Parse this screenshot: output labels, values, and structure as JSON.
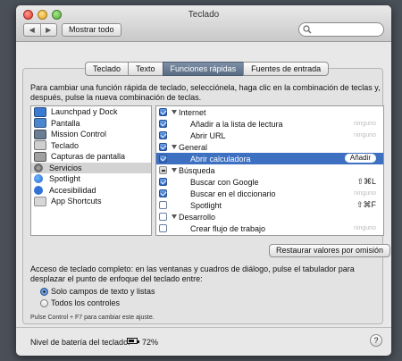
{
  "window": {
    "title": "Teclado"
  },
  "toolbar": {
    "back": "◀",
    "forward": "▶",
    "show_all": "Mostrar todo"
  },
  "tabs": [
    {
      "label": "Teclado",
      "active": false
    },
    {
      "label": "Texto",
      "active": false
    },
    {
      "label": "Funciones rápidas",
      "active": true
    },
    {
      "label": "Fuentes de entrada",
      "active": false
    }
  ],
  "intro": "Para cambiar una función rápida de teclado, selecciónela, haga clic en la combinación de teclas y, después, pulse la nueva combinación de teclas.",
  "categories": [
    {
      "label": "Launchpad y Dock",
      "icon": "launchpad-icon",
      "selected": false
    },
    {
      "label": "Pantalla",
      "icon": "display-icon",
      "selected": false
    },
    {
      "label": "Mission Control",
      "icon": "mission-control-icon",
      "selected": false
    },
    {
      "label": "Teclado",
      "icon": "keyboard-icon",
      "selected": false
    },
    {
      "label": "Capturas de pantalla",
      "icon": "screenshot-icon",
      "selected": false
    },
    {
      "label": "Servicios",
      "icon": "gear-icon",
      "selected": true
    },
    {
      "label": "Spotlight",
      "icon": "spotlight-icon",
      "selected": false
    },
    {
      "label": "Accesibilidad",
      "icon": "accessibility-icon",
      "selected": false
    },
    {
      "label": "App Shortcuts",
      "icon": "app-shortcuts-icon",
      "selected": false
    }
  ],
  "shortcuts": [
    {
      "label": "Internet",
      "group": true,
      "state": "checked",
      "key": ""
    },
    {
      "label": "Añadir a la lista de lectura",
      "group": false,
      "state": "checked",
      "key": "ninguno"
    },
    {
      "label": "Abrir URL",
      "group": false,
      "state": "checked",
      "key": "ninguno"
    },
    {
      "label": "General",
      "group": true,
      "state": "checked",
      "key": ""
    },
    {
      "label": "Abrir calculadora",
      "group": false,
      "state": "checked",
      "key": "Añadir",
      "selected": true
    },
    {
      "label": "Búsqueda",
      "group": true,
      "state": "mixed",
      "key": ""
    },
    {
      "label": "Buscar con Google",
      "group": false,
      "state": "checked",
      "key": "⇧⌘L",
      "strong": true
    },
    {
      "label": "Buscar en el diccionario",
      "group": false,
      "state": "checked",
      "key": "ninguno"
    },
    {
      "label": "Spotlight",
      "group": false,
      "state": "unchecked",
      "key": "⇧⌘F",
      "strong": true
    },
    {
      "label": "Desarrollo",
      "group": true,
      "state": "unchecked",
      "key": ""
    },
    {
      "label": "Crear flujo de trabajo",
      "group": false,
      "state": "unchecked",
      "key": "ninguno"
    }
  ],
  "restore_button": "Restaurar valores por omisión",
  "access": {
    "text": "Acceso de teclado completo: en las ventanas y cuadros de diálogo, pulse el tabulador para desplazar el punto de enfoque del teclado entre:",
    "options": [
      {
        "label": "Solo campos de texto y listas",
        "selected": true
      },
      {
        "label": "Todos los controles",
        "selected": false
      }
    ],
    "hint": "Pulse Control + F7 para cambiar este ajuste."
  },
  "battery": {
    "label": "Nivel de batería del teclado:",
    "value": "72%"
  },
  "help": "?"
}
